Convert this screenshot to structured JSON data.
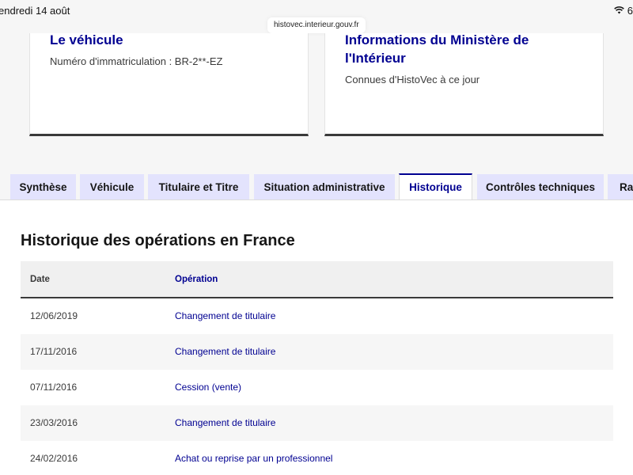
{
  "status_bar": {
    "time": "endredi 14 août",
    "battery": "6"
  },
  "browser": {
    "url": "histovec.interieur.gouv.fr"
  },
  "cards": [
    {
      "title": "Le véhicule",
      "description": "Numéro d'immatriculation : BR-2**-EZ"
    },
    {
      "title": "Informations du Ministère de l'Intérieur",
      "description": "Connues d'HistoVec à ce jour"
    }
  ],
  "tabs": [
    {
      "label": "Synthèse",
      "active": false
    },
    {
      "label": "Véhicule",
      "active": false
    },
    {
      "label": "Titulaire et Titre",
      "active": false
    },
    {
      "label": "Situation administrative",
      "active": false
    },
    {
      "label": "Historique",
      "active": true
    },
    {
      "label": "Contrôles techniques",
      "active": false
    },
    {
      "label": "Rap",
      "active": false
    }
  ],
  "history": {
    "title": "Historique des opérations en France",
    "columns": {
      "date": "Date",
      "operation": "Opération"
    },
    "rows": [
      {
        "date": "12/06/2019",
        "operation": "Changement de titulaire"
      },
      {
        "date": "17/11/2016",
        "operation": "Changement de titulaire"
      },
      {
        "date": "07/11/2016",
        "operation": "Cession (vente)"
      },
      {
        "date": "23/03/2016",
        "operation": "Changement de titulaire"
      },
      {
        "date": "24/02/2016",
        "operation": "Achat ou reprise par un professionnel"
      }
    ]
  },
  "colors": {
    "accent": "#000091",
    "tab_bg": "#e3e3fd"
  }
}
